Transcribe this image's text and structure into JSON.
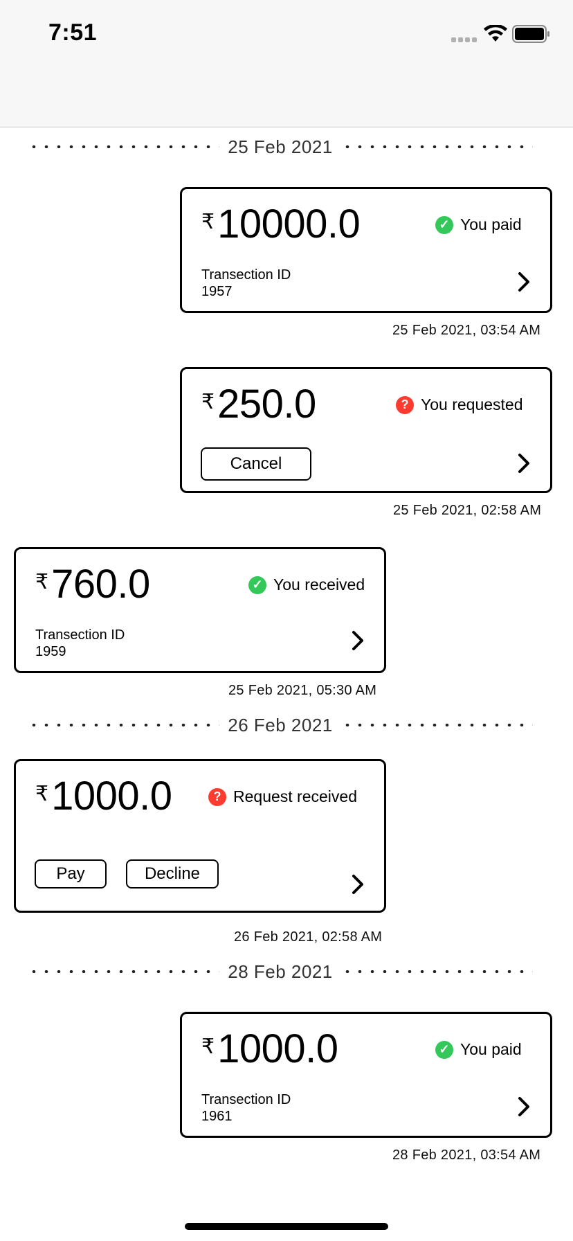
{
  "status_bar": {
    "time": "7:51",
    "icons": [
      "signal-icon",
      "wifi-icon",
      "battery-icon"
    ]
  },
  "currency_symbol": "₹",
  "dividers": [
    {
      "label": "25 Feb 2021"
    },
    {
      "label": "26 Feb 2021"
    },
    {
      "label": "28 Feb 2021"
    }
  ],
  "transactions": [
    {
      "amount": "10000.0",
      "status": "You paid",
      "status_icon": "check-circle-icon",
      "txn_label": "Transection ID",
      "txn_id": "1957",
      "timestamp": "25 Feb 2021, 03:54 AM"
    },
    {
      "amount": "250.0",
      "status": "You requested",
      "status_icon": "question-circle-icon",
      "cancel_label": "Cancel",
      "timestamp": "25 Feb 2021, 02:58 AM"
    },
    {
      "amount": "760.0",
      "status": "You received",
      "status_icon": "check-circle-icon",
      "txn_label": "Transection ID",
      "txn_id": "1959",
      "timestamp": "25 Feb 2021, 05:30 AM"
    },
    {
      "amount": "1000.0",
      "status": "Request received",
      "status_icon": "question-circle-icon",
      "pay_label": "Pay",
      "decline_label": "Decline",
      "timestamp": "26 Feb 2021, 02:58 AM"
    },
    {
      "amount": "1000.0",
      "status": "You paid",
      "status_icon": "check-circle-icon",
      "txn_label": "Transection ID",
      "txn_id": "1961",
      "timestamp": "28 Feb 2021, 03:54 AM"
    }
  ],
  "colors": {
    "success": "#34c759",
    "pending": "#ff3b30",
    "status_bar_bg": "#f7f7f7"
  }
}
